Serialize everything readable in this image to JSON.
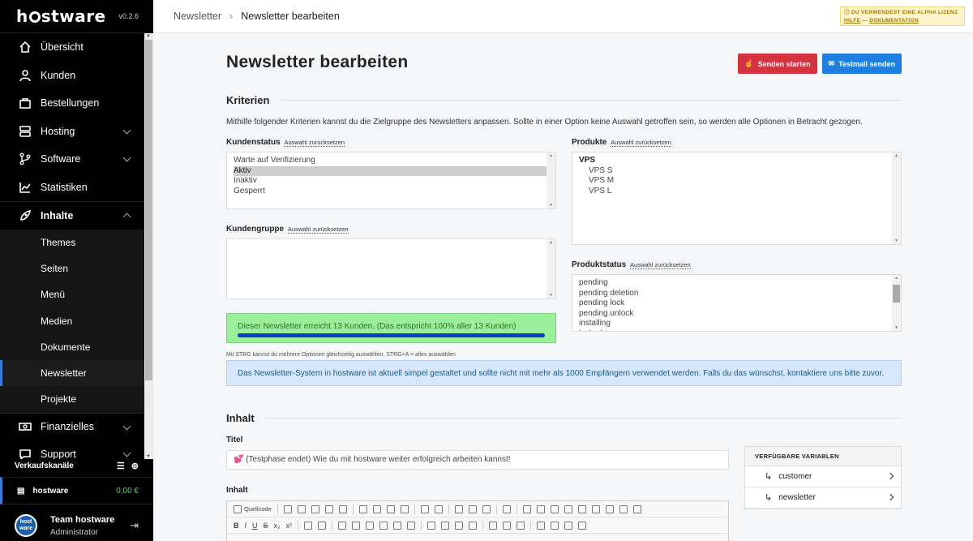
{
  "app": {
    "logo": "hostware",
    "version": "v0.2.6"
  },
  "sidebar": {
    "items": [
      {
        "label": "Übersicht",
        "icon": "home-icon"
      },
      {
        "label": "Kunden",
        "icon": "user-icon"
      },
      {
        "label": "Bestellungen",
        "icon": "cart-icon"
      },
      {
        "label": "Hosting",
        "icon": "server-icon"
      },
      {
        "label": "Software",
        "icon": "branch-icon"
      },
      {
        "label": "Statistiken",
        "icon": "chart-icon"
      },
      {
        "label": "Inhalte",
        "icon": "rocket-icon"
      }
    ],
    "subitems": [
      "Themes",
      "Seiten",
      "Menü",
      "Medien",
      "Dokumente",
      "Newsletter",
      "Projekte"
    ],
    "after": [
      {
        "label": "Finanzielles",
        "icon": "money-icon"
      },
      {
        "label": "Support",
        "icon": "chat-icon"
      }
    ],
    "sales_title": "Verkaufskanäle",
    "channel": {
      "name": "hostware",
      "value": "0,00 €"
    },
    "user": {
      "name": "Team hostware",
      "role": "Administrator",
      "avatar_text": "host ware"
    }
  },
  "topbar": {
    "crumb1": "Newsletter",
    "crumb2": "Newsletter bearbeiten",
    "alpha_line1": "DU VERWENDEST EINE ALPHA LIZENZ",
    "alpha_help": "HILFE",
    "alpha_dash": " — ",
    "alpha_docs": "DOKUMENTATION"
  },
  "page": {
    "title": "Newsletter bearbeiten",
    "send_button": "Senden starten",
    "testmail_button": "Testmail senden",
    "kriterien_title": "Kriterien",
    "kriterien_desc": "Mithilfe folgender Kriterien kannst du die Zielgruppe des Newsletters anpassen. Sollte in einer Option keine Auswahl getroffen sein, so werden alle Optionen in Betracht gezogen.",
    "reset_label": "Auswahl zurücksetzen",
    "kundenstatus": {
      "label": "Kundenstatus",
      "options": [
        "Warte auf Verifizierung",
        "Aktiv",
        "Inaktiv",
        "Gesperrt"
      ],
      "selected": "Aktiv"
    },
    "kundengruppe": {
      "label": "Kundengruppe"
    },
    "produkte": {
      "label": "Produkte",
      "group": "VPS",
      "options": [
        "VPS S",
        "VPS M",
        "VPS L"
      ]
    },
    "produktstatus": {
      "label": "Produktstatus",
      "options": [
        "pending",
        "pending deletion",
        "pending lock",
        "pending unlock",
        "installing",
        "locked"
      ]
    },
    "reach_text": "Dieser Newsletter erreicht 13 Kunden. (Das entspricht 100% aller 13 Kunden)",
    "reach_percent": 100,
    "hint": "Mit STRG kannst du mehrere Optionen gleichzeitig auswählen. STRG+A = alles auswählen",
    "info": "Das Newsletter-System in hostware ist aktuell simpel gestaltet und sollte nicht mit mehr als 1000 Empfängern verwendet werden. Falls du das wünschst, kontaktiere uns bitte zuvor.",
    "inhalt_title": "Inhalt",
    "titel_label": "Titel",
    "titel_value": "💕 (Testphase endet) Wie du mit hostware weiter erfolgreich arbeiten kannst!",
    "inhalt_label": "Inhalt",
    "editor_source": "Quellcode",
    "vars_title": "VERFÜGBARE VARIABLEN",
    "vars": [
      "customer",
      "newsletter"
    ]
  },
  "colors": {
    "accent": "#3a7bd5",
    "danger": "#d63340",
    "primary": "#1e7fe0",
    "success_bg": "#9af09a",
    "info_bg": "#d5e7f8"
  }
}
